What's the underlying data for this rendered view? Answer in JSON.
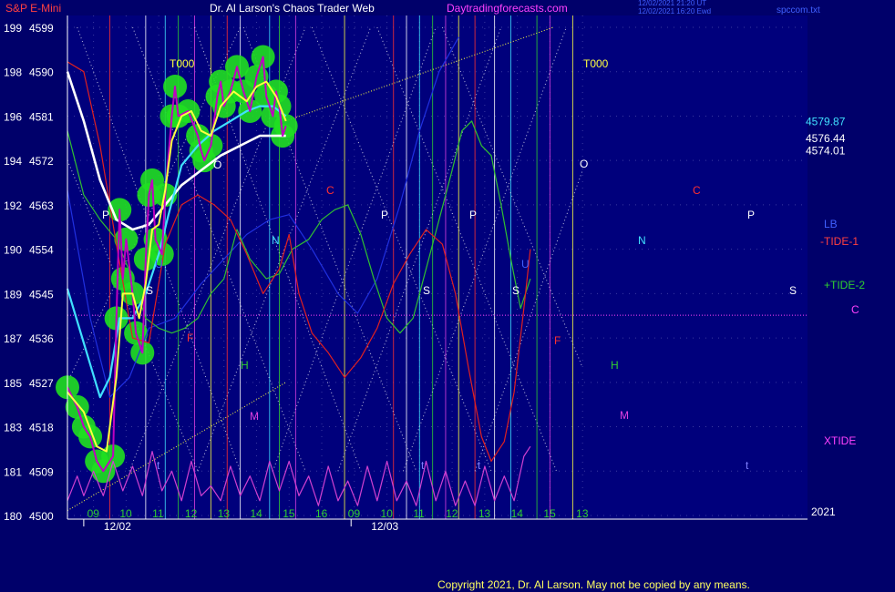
{
  "header": {
    "instrument": "S&P E-Mini",
    "title": "Dr. Al Larson's Chaos Trader Web",
    "site": "Daytradingforecasts.com",
    "stamp1": "12/02/2021 21:20 UT",
    "stamp2": "12/02/2021 16:20 Ewd",
    "corner": "spccom.txt"
  },
  "footer": {
    "copyright": "Copyright 2021, Dr. Al Larson. May not be copied by any means.",
    "year": "2021"
  },
  "colors": {
    "background": "#00006a",
    "plot": "#00007c",
    "price": "#c000c0",
    "ema_fast": "#ffff40",
    "ema_mid": "#40e0ff",
    "ema_slow": "#ffffff",
    "tide1": "#e02020",
    "tide2": "#30c030",
    "xtide": "#d040d0",
    "lb": "#2030e0",
    "glow": "#20e020"
  },
  "chart_data": {
    "type": "line",
    "title": "S&P E-Mini",
    "y_axis": {
      "range": [
        4500,
        4599
      ],
      "ticks": [
        {
          "left": "199",
          "right": "4599",
          "value": 4599
        },
        {
          "left": "198",
          "right": "4590",
          "value": 4590
        },
        {
          "left": "196",
          "right": "4581",
          "value": 4581
        },
        {
          "left": "194",
          "right": "4572",
          "value": 4572
        },
        {
          "left": "192",
          "right": "4563",
          "value": 4563
        },
        {
          "left": "190",
          "right": "4554",
          "value": 4554
        },
        {
          "left": "189",
          "right": "4545",
          "value": 4545
        },
        {
          "left": "187",
          "right": "4536",
          "value": 4536
        },
        {
          "left": "185",
          "right": "4527",
          "value": 4527
        },
        {
          "left": "183",
          "right": "4518",
          "value": 4518
        },
        {
          "left": "181",
          "right": "4509",
          "value": 4509
        },
        {
          "left": "180",
          "right": "4500",
          "value": 4500
        }
      ]
    },
    "x_axis": {
      "range": [
        8.5,
        31.2
      ],
      "ticks": [
        {
          "label": "09",
          "x": 9.3
        },
        {
          "label": "10",
          "x": 10.3
        },
        {
          "label": "11",
          "x": 11.3
        },
        {
          "label": "12",
          "x": 12.3
        },
        {
          "label": "13",
          "x": 13.3
        },
        {
          "label": "14",
          "x": 14.3
        },
        {
          "label": "15",
          "x": 15.3
        },
        {
          "label": "16",
          "x": 16.3
        },
        {
          "label": "09",
          "x": 17.3
        },
        {
          "label": "10",
          "x": 18.3
        },
        {
          "label": "11",
          "x": 19.3
        },
        {
          "label": "12",
          "x": 20.3
        },
        {
          "label": "13",
          "x": 21.3
        },
        {
          "label": "14",
          "x": 22.3
        },
        {
          "label": "15",
          "x": 23.3
        },
        {
          "label": "13",
          "x": 24.3
        }
      ],
      "dates": [
        {
          "label": "12/02",
          "x": 9.0
        },
        {
          "label": "12/03",
          "x": 17.2
        }
      ]
    },
    "series": [
      {
        "name": "price",
        "values": [
          [
            8.5,
            4526
          ],
          [
            8.8,
            4522
          ],
          [
            9.0,
            4518
          ],
          [
            9.2,
            4516
          ],
          [
            9.4,
            4511
          ],
          [
            9.6,
            4509
          ],
          [
            9.9,
            4512
          ],
          [
            10.0,
            4540
          ],
          [
            10.1,
            4562
          ],
          [
            10.2,
            4548
          ],
          [
            10.3,
            4556
          ],
          [
            10.5,
            4545
          ],
          [
            10.6,
            4537
          ],
          [
            10.8,
            4533
          ],
          [
            10.9,
            4552
          ],
          [
            11.0,
            4565
          ],
          [
            11.1,
            4568
          ],
          [
            11.2,
            4556
          ],
          [
            11.4,
            4553
          ],
          [
            11.5,
            4565
          ],
          [
            11.7,
            4581
          ],
          [
            11.8,
            4587
          ],
          [
            11.9,
            4581
          ],
          [
            12.2,
            4582
          ],
          [
            12.5,
            4577
          ],
          [
            12.6,
            4574
          ],
          [
            12.7,
            4572
          ],
          [
            12.9,
            4575
          ],
          [
            13.1,
            4585
          ],
          [
            13.2,
            4588
          ],
          [
            13.3,
            4583
          ],
          [
            13.5,
            4586
          ],
          [
            13.7,
            4591
          ],
          [
            13.9,
            4586
          ],
          [
            14.1,
            4582
          ],
          [
            14.3,
            4589
          ],
          [
            14.5,
            4593
          ],
          [
            14.6,
            4585
          ],
          [
            14.8,
            4581
          ],
          [
            14.9,
            4586
          ],
          [
            15.0,
            4583
          ],
          [
            15.1,
            4577
          ],
          [
            15.2,
            4579
          ]
        ]
      },
      {
        "name": "ema_fast",
        "values": [
          [
            8.5,
            4525
          ],
          [
            9.0,
            4521
          ],
          [
            9.4,
            4514
          ],
          [
            9.7,
            4513
          ],
          [
            10.0,
            4528
          ],
          [
            10.2,
            4545
          ],
          [
            10.5,
            4545
          ],
          [
            10.7,
            4540
          ],
          [
            10.9,
            4547
          ],
          [
            11.1,
            4558
          ],
          [
            11.3,
            4559
          ],
          [
            11.5,
            4566
          ],
          [
            11.7,
            4576
          ],
          [
            12.0,
            4581
          ],
          [
            12.3,
            4582
          ],
          [
            12.6,
            4578
          ],
          [
            12.9,
            4577
          ],
          [
            13.2,
            4583
          ],
          [
            13.6,
            4586
          ],
          [
            14.0,
            4584
          ],
          [
            14.3,
            4587
          ],
          [
            14.6,
            4588
          ],
          [
            14.9,
            4585
          ],
          [
            15.2,
            4580
          ]
        ]
      },
      {
        "name": "ema_mid",
        "values": [
          [
            8.5,
            4546
          ],
          [
            9.0,
            4535
          ],
          [
            9.5,
            4524
          ],
          [
            9.8,
            4528
          ],
          [
            10.1,
            4540
          ],
          [
            10.5,
            4540
          ],
          [
            10.9,
            4545
          ],
          [
            11.3,
            4553
          ],
          [
            11.6,
            4561
          ],
          [
            12.0,
            4571
          ],
          [
            12.5,
            4575
          ],
          [
            13.0,
            4578
          ],
          [
            13.5,
            4580
          ],
          [
            14.0,
            4582
          ],
          [
            14.4,
            4583
          ],
          [
            14.8,
            4583
          ],
          [
            15.2,
            4581
          ]
        ]
      },
      {
        "name": "ema_slow",
        "values": [
          [
            8.5,
            4590
          ],
          [
            9.0,
            4580
          ],
          [
            9.5,
            4568
          ],
          [
            10.0,
            4560
          ],
          [
            10.5,
            4558
          ],
          [
            11.0,
            4559
          ],
          [
            11.5,
            4563
          ],
          [
            12.0,
            4567
          ],
          [
            12.6,
            4570
          ],
          [
            13.2,
            4573
          ],
          [
            13.8,
            4575
          ],
          [
            14.4,
            4577
          ],
          [
            14.9,
            4577
          ],
          [
            15.2,
            4577
          ]
        ]
      },
      {
        "name": "TIDE-1",
        "values": [
          [
            8.5,
            4592
          ],
          [
            9.0,
            4590
          ],
          [
            9.5,
            4575
          ],
          [
            10.0,
            4555
          ],
          [
            10.5,
            4536
          ],
          [
            11.0,
            4535
          ],
          [
            11.5,
            4555
          ],
          [
            12.0,
            4563
          ],
          [
            12.5,
            4565
          ],
          [
            13.0,
            4563
          ],
          [
            13.5,
            4560
          ],
          [
            14.0,
            4553
          ],
          [
            14.5,
            4545
          ],
          [
            15.0,
            4550
          ],
          [
            15.3,
            4557
          ],
          [
            15.6,
            4545
          ],
          [
            16.0,
            4537
          ],
          [
            16.5,
            4533
          ],
          [
            17.0,
            4528
          ],
          [
            17.5,
            4532
          ],
          [
            18.0,
            4538
          ],
          [
            18.5,
            4547
          ],
          [
            19.0,
            4553
          ],
          [
            19.5,
            4558
          ],
          [
            20.0,
            4555
          ],
          [
            20.4,
            4545
          ],
          [
            20.8,
            4530
          ],
          [
            21.2,
            4516
          ],
          [
            21.5,
            4511
          ],
          [
            21.9,
            4515
          ],
          [
            22.2,
            4525
          ],
          [
            22.5,
            4542
          ],
          [
            22.7,
            4554
          ]
        ]
      },
      {
        "name": "+TIDE-2",
        "values": [
          [
            8.5,
            4578
          ],
          [
            9.0,
            4565
          ],
          [
            9.5,
            4560
          ],
          [
            10.0,
            4556
          ],
          [
            10.5,
            4548
          ],
          [
            10.9,
            4540
          ],
          [
            11.3,
            4538
          ],
          [
            11.7,
            4537
          ],
          [
            12.1,
            4538
          ],
          [
            12.5,
            4540
          ],
          [
            12.9,
            4545
          ],
          [
            13.3,
            4548
          ],
          [
            13.7,
            4558
          ],
          [
            14.1,
            4552
          ],
          [
            14.6,
            4548
          ],
          [
            15.0,
            4549
          ],
          [
            15.4,
            4554
          ],
          [
            15.9,
            4556
          ],
          [
            16.3,
            4560
          ],
          [
            16.7,
            4562
          ],
          [
            17.1,
            4563
          ],
          [
            17.5,
            4557
          ],
          [
            17.9,
            4548
          ],
          [
            18.3,
            4540
          ],
          [
            18.7,
            4537
          ],
          [
            19.1,
            4540
          ],
          [
            19.5,
            4550
          ],
          [
            19.9,
            4560
          ],
          [
            20.3,
            4570
          ],
          [
            20.6,
            4578
          ],
          [
            20.9,
            4580
          ],
          [
            21.2,
            4575
          ],
          [
            21.5,
            4573
          ],
          [
            21.8,
            4563
          ],
          [
            22.1,
            4552
          ],
          [
            22.4,
            4542
          ],
          [
            22.7,
            4548
          ]
        ]
      },
      {
        "name": "XTIDE",
        "values": [
          [
            8.5,
            4503
          ],
          [
            8.8,
            4508
          ],
          [
            9.0,
            4504
          ],
          [
            9.3,
            4509
          ],
          [
            9.6,
            4504
          ],
          [
            9.9,
            4511
          ],
          [
            10.2,
            4505
          ],
          [
            10.5,
            4510
          ],
          [
            10.8,
            4504
          ],
          [
            11.1,
            4513
          ],
          [
            11.4,
            4505
          ],
          [
            11.7,
            4509
          ],
          [
            12.0,
            4503
          ],
          [
            12.3,
            4511
          ],
          [
            12.6,
            4504
          ],
          [
            12.9,
            4506
          ],
          [
            13.2,
            4503
          ],
          [
            13.5,
            4510
          ],
          [
            13.8,
            4504
          ],
          [
            14.1,
            4508
          ],
          [
            14.4,
            4503
          ],
          [
            14.7,
            4511
          ],
          [
            15.0,
            4505
          ],
          [
            15.3,
            4511
          ],
          [
            15.6,
            4504
          ],
          [
            15.9,
            4508
          ],
          [
            16.2,
            4502
          ],
          [
            16.5,
            4510
          ],
          [
            16.8,
            4503
          ],
          [
            17.1,
            4507
          ],
          [
            17.4,
            4502
          ],
          [
            17.7,
            4510
          ],
          [
            18.0,
            4503
          ],
          [
            18.3,
            4511
          ],
          [
            18.6,
            4503
          ],
          [
            18.9,
            4507
          ],
          [
            19.2,
            4502
          ],
          [
            19.5,
            4511
          ],
          [
            19.8,
            4503
          ],
          [
            20.1,
            4509
          ],
          [
            20.4,
            4502
          ],
          [
            20.7,
            4507
          ],
          [
            21.0,
            4502
          ],
          [
            21.3,
            4510
          ],
          [
            21.6,
            4503
          ],
          [
            21.9,
            4508
          ],
          [
            22.2,
            4503
          ],
          [
            22.5,
            4512
          ],
          [
            22.7,
            4514
          ]
        ]
      },
      {
        "name": "LB",
        "values": [
          [
            8.5,
            4566
          ],
          [
            9.2,
            4540
          ],
          [
            9.8,
            4524
          ],
          [
            10.4,
            4528
          ],
          [
            11.0,
            4538
          ],
          [
            11.8,
            4540
          ],
          [
            12.6,
            4547
          ],
          [
            13.3,
            4552
          ],
          [
            14.0,
            4557
          ],
          [
            14.7,
            4560
          ],
          [
            15.3,
            4561
          ],
          [
            16.0,
            4554
          ],
          [
            16.8,
            4545
          ],
          [
            17.4,
            4541
          ],
          [
            18.0,
            4548
          ],
          [
            18.7,
            4563
          ],
          [
            19.3,
            4578
          ],
          [
            19.9,
            4590
          ],
          [
            20.5,
            4597
          ]
        ]
      }
    ],
    "levels": [
      {
        "label": "4579.87",
        "value": 4579.87
      },
      {
        "label": "4576.44",
        "value": 4576.44
      },
      {
        "label": "4574.01",
        "value": 4574.01
      }
    ],
    "legend": [
      "LB",
      "-TIDE-1",
      "+TIDE-2",
      "C",
      "XTIDE"
    ],
    "annotations": [
      "T000",
      "T000",
      "P",
      "P",
      "P",
      "P",
      "O",
      "O",
      "S",
      "S",
      "S",
      "S",
      "N",
      "N",
      "H",
      "H",
      "M",
      "M",
      "C",
      "C",
      "t",
      "t",
      "t",
      "t",
      "F",
      "F",
      "U",
      "U"
    ]
  }
}
